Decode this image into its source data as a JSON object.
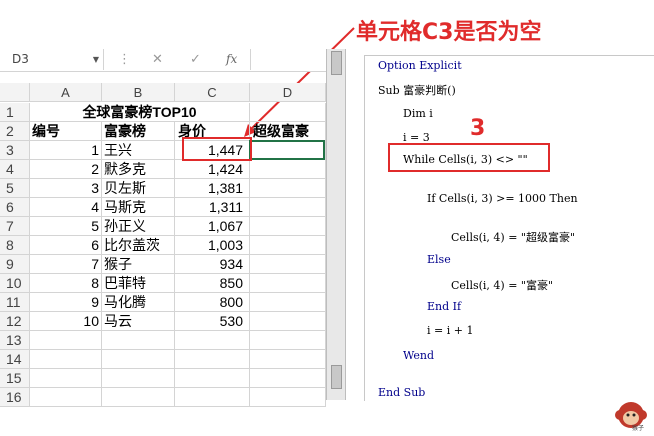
{
  "annotation": {
    "title": "单元格C3是否为空",
    "step": "3"
  },
  "formula_bar": {
    "name_box": "D3",
    "fx": "fx",
    "cancel": "✕",
    "enter": "✓"
  },
  "sheet": {
    "columns": [
      "A",
      "B",
      "C",
      "D"
    ],
    "title": "全球富豪榜TOP10",
    "headers": [
      "编号",
      "富豪榜",
      "身价",
      "超级富豪"
    ],
    "rows": [
      {
        "id": "1",
        "name": "王兴",
        "value": "1,447"
      },
      {
        "id": "2",
        "name": "默多克",
        "value": "1,424"
      },
      {
        "id": "3",
        "name": "贝左斯",
        "value": "1,381"
      },
      {
        "id": "4",
        "name": "马斯克",
        "value": "1,311"
      },
      {
        "id": "5",
        "name": "孙正义",
        "value": "1,067"
      },
      {
        "id": "6",
        "name": "比尔盖茨",
        "value": "1,003"
      },
      {
        "id": "7",
        "name": "猴子",
        "value": "934"
      },
      {
        "id": "8",
        "name": "巴菲特",
        "value": "850"
      },
      {
        "id": "9",
        "name": "马化腾",
        "value": "800"
      },
      {
        "id": "10",
        "name": "马云",
        "value": "530"
      }
    ],
    "row_numbers": [
      "1",
      "2",
      "3",
      "4",
      "5",
      "6",
      "7",
      "8",
      "9",
      "10",
      "11",
      "12",
      "13",
      "14",
      "15",
      "16"
    ]
  },
  "vba": {
    "line1": "Option Explicit",
    "line2": "Sub 富豪判断()",
    "line3": "Dim i",
    "line4": "i = 3",
    "line5": "While Cells(i, 3) <> \"\"",
    "line6": "If Cells(i, 3) >= 1000 Then",
    "line7": "Cells(i, 4) = \"超级富豪\"",
    "line8": "Else",
    "line9": "Cells(i, 4) = \"富豪\"",
    "line10": "End If",
    "line11": "i = i + 1",
    "line12": "Wend",
    "line13": "End Sub"
  },
  "logo_text": "猴子",
  "colors": {
    "accent_red": "#e02b2b",
    "keyword_blue": "#00008b",
    "selection_green": "#217346"
  }
}
